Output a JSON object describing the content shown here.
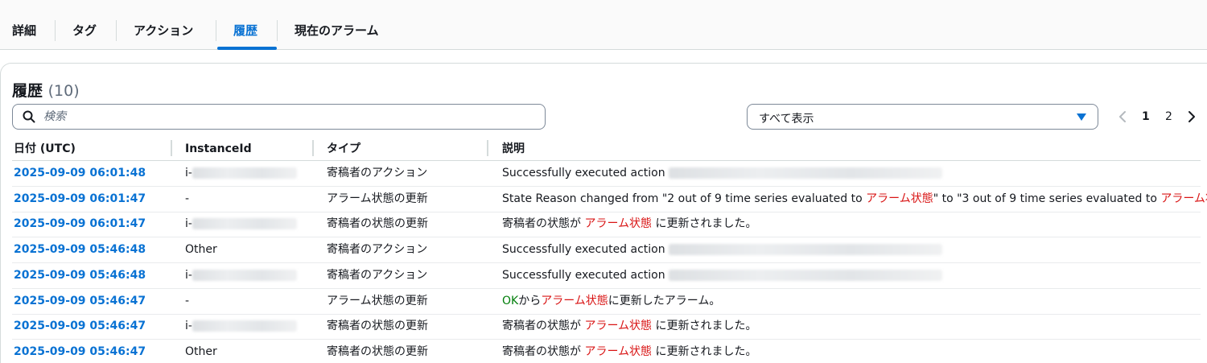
{
  "tabs": [
    {
      "label": "詳細"
    },
    {
      "label": "タグ"
    },
    {
      "label": "アクション"
    },
    {
      "label": "履歴"
    },
    {
      "label": "現在のアラーム"
    }
  ],
  "active_tab": "履歴",
  "section": {
    "title": "履歴",
    "count": "(10)"
  },
  "search": {
    "placeholder": "検索"
  },
  "filter": {
    "selected": "すべて表示"
  },
  "pagination": {
    "pages": [
      "1",
      "2"
    ],
    "current": "1"
  },
  "table": {
    "columns": [
      "日付 (UTC)",
      "InstanceId",
      "タイプ",
      "説明"
    ],
    "rows": [
      {
        "date": "2025-09-09 06:01:48",
        "instance": "i-",
        "type": "寄稿者のアクション",
        "desc": [
          {
            "t": "Successfully executed action "
          }
        ]
      },
      {
        "date": "2025-09-09 06:01:47",
        "instance": "-",
        "type": "アラーム状態の更新",
        "desc": [
          {
            "t": "State Reason changed from \"2 out of 9 time series evaluated to "
          },
          {
            "t": "アラーム状態"
          },
          {
            "t": "\" to \"3 out of 9 time series evaluated to "
          },
          {
            "t": "アラーム状態"
          },
          {
            "t": "\""
          }
        ]
      },
      {
        "date": "2025-09-09 06:01:47",
        "instance": "i-",
        "type": "寄稿者の状態の更新",
        "desc": [
          {
            "t": "寄稿者の状態が "
          },
          {
            "t": "アラーム状態"
          },
          {
            "t": " に更新されました。"
          }
        ]
      },
      {
        "date": "2025-09-09 05:46:48",
        "instance": "Other",
        "type": "寄稿者のアクション",
        "desc": [
          {
            "t": "Successfully executed action "
          }
        ]
      },
      {
        "date": "2025-09-09 05:46:48",
        "instance": "i-",
        "type": "寄稿者のアクション",
        "desc": [
          {
            "t": "Successfully executed action "
          }
        ]
      },
      {
        "date": "2025-09-09 05:46:47",
        "instance": "-",
        "type": "アラーム状態の更新",
        "desc": [
          {
            "t": "OK"
          },
          {
            "t": "から"
          },
          {
            "t": "アラーム状態"
          },
          {
            "t": "に更新したアラーム。"
          }
        ]
      },
      {
        "date": "2025-09-09 05:46:47",
        "instance": "i-",
        "type": "寄稿者の状態の更新",
        "desc": [
          {
            "t": "寄稿者の状態が "
          },
          {
            "t": "アラーム状態"
          },
          {
            "t": " に更新されました。"
          }
        ]
      },
      {
        "date": "2025-09-09 05:46:47",
        "instance": "Other",
        "type": "寄稿者の状態の更新",
        "desc": [
          {
            "t": "寄稿者の状態が "
          },
          {
            "t": "アラーム状態"
          },
          {
            "t": " に更新されました。"
          }
        ]
      }
    ]
  },
  "colors": {
    "link": "#0972d3",
    "alarm": "#d91515",
    "ok": "#037f0c",
    "border": "#d5dbdb"
  }
}
